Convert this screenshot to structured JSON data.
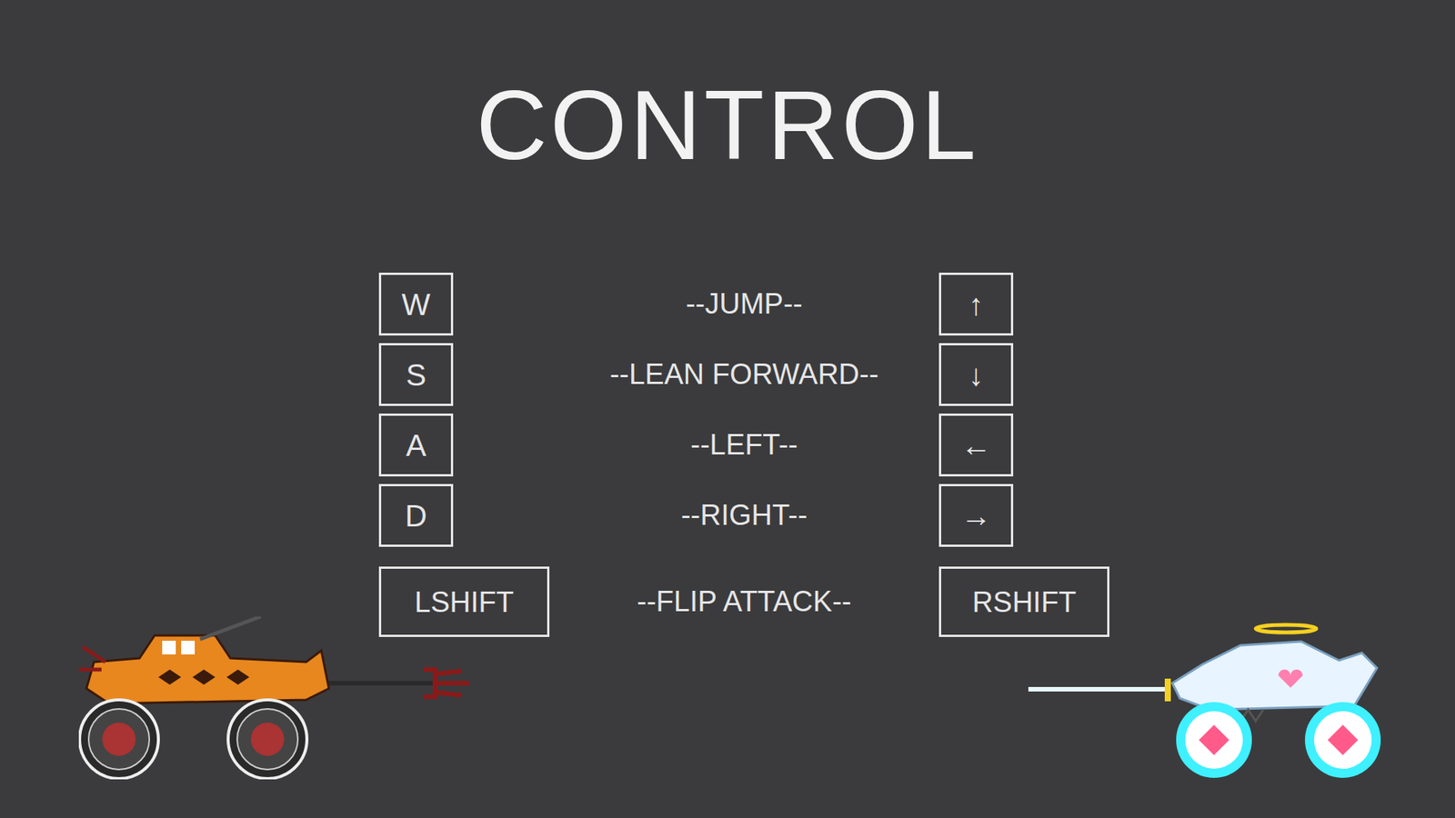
{
  "title": "CONTROL",
  "bindings": [
    {
      "action": "--JUMP--",
      "left_key": "W",
      "right_key": "↑",
      "kind": "key"
    },
    {
      "action": "--LEAN FORWARD--",
      "left_key": "S",
      "right_key": "↓",
      "kind": "key"
    },
    {
      "action": "--LEFT--",
      "left_key": "A",
      "right_key": "←",
      "kind": "key"
    },
    {
      "action": "--RIGHT--",
      "left_key": "D",
      "right_key": "→",
      "kind": "key"
    },
    {
      "action": "--FLIP ATTACK--",
      "left_key": "LSHIFT",
      "right_key": "RSHIFT",
      "kind": "wide"
    }
  ]
}
